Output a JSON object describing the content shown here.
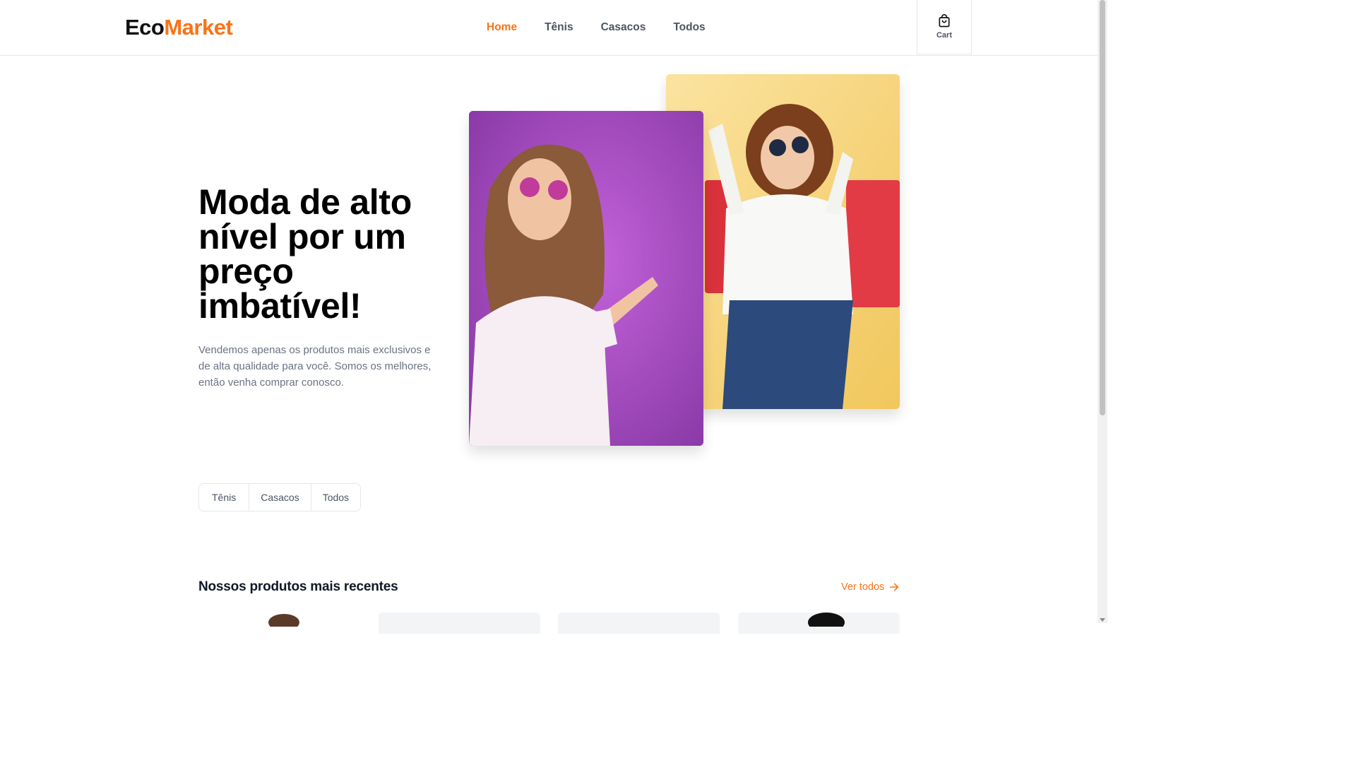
{
  "brand": {
    "part1": "Eco",
    "part2": "Market",
    "accent_color": "#f97316"
  },
  "nav": {
    "items": [
      {
        "label": "Home",
        "active": true
      },
      {
        "label": "Tênis",
        "active": false
      },
      {
        "label": "Casacos",
        "active": false
      },
      {
        "label": "Todos",
        "active": false
      }
    ]
  },
  "cart": {
    "label": "Cart",
    "icon": "shopping-bag-icon"
  },
  "hero": {
    "title": "Moda de alto nível por um preço imbatível!",
    "description": "Vendemos apenas os produtos mais exclusivos e de alta qualidade para você. Somos os melhores, então venha comprar conosco."
  },
  "categories": [
    "Tênis",
    "Casacos",
    "Todos"
  ],
  "products_section": {
    "title": "Nossos produtos mais recentes",
    "see_all": "Ver todos"
  }
}
